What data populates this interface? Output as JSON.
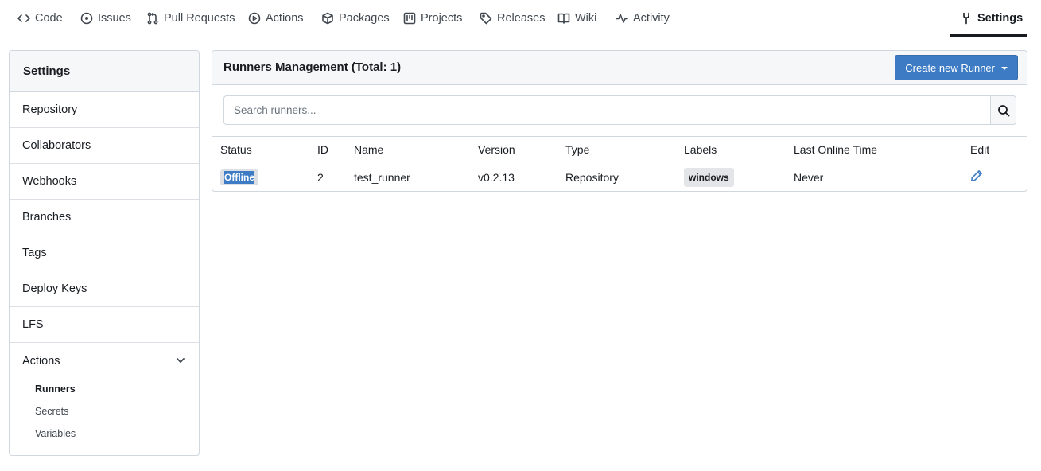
{
  "nav": {
    "items": [
      {
        "label": "Code",
        "icon": "code-icon"
      },
      {
        "label": "Issues",
        "icon": "issue-icon"
      },
      {
        "label": "Pull Requests",
        "icon": "pull-request-icon"
      },
      {
        "label": "Actions",
        "icon": "play-icon"
      },
      {
        "label": "Packages",
        "icon": "package-icon"
      },
      {
        "label": "Projects",
        "icon": "project-icon"
      },
      {
        "label": "Releases",
        "icon": "tag-icon"
      },
      {
        "label": "Wiki",
        "icon": "book-icon"
      },
      {
        "label": "Activity",
        "icon": "pulse-icon"
      }
    ],
    "settings_label": "Settings"
  },
  "sidebar": {
    "title": "Settings",
    "items": [
      "Repository",
      "Collaborators",
      "Webhooks",
      "Branches",
      "Tags",
      "Deploy Keys",
      "LFS",
      "Actions"
    ],
    "sub_items": [
      "Runners",
      "Secrets",
      "Variables"
    ],
    "active_sub": "Runners"
  },
  "panel": {
    "title": "Runners Management (Total: 1)",
    "create_button": "Create new Runner",
    "search_placeholder": "Search runners..."
  },
  "table": {
    "headers": [
      "Status",
      "ID",
      "Name",
      "Version",
      "Type",
      "Labels",
      "Last Online Time",
      "Edit"
    ],
    "rows": [
      {
        "status": "Offline",
        "id": "2",
        "name": "test_runner",
        "version": "v0.2.13",
        "type": "Repository",
        "labels": "windows",
        "last_online": "Never"
      }
    ]
  },
  "colors": {
    "accent": "#3d7cc4",
    "border": "#d0d7de",
    "header_bg": "#f6f7f9"
  }
}
